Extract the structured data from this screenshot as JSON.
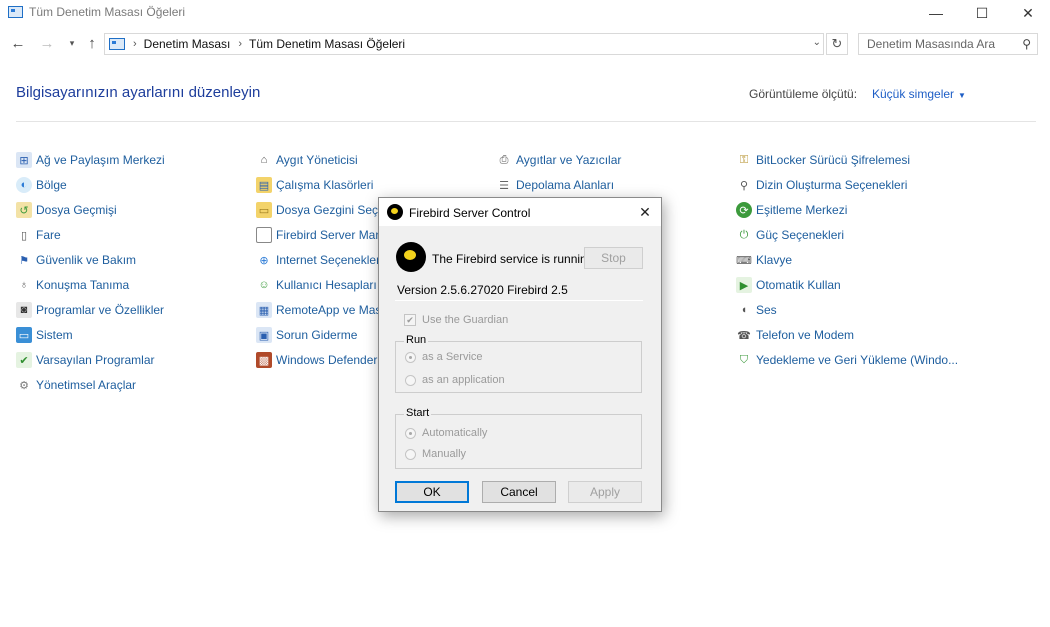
{
  "window": {
    "title": "Tüm Denetim Masası Öğeleri",
    "minimize_glyph": "—",
    "maximize_glyph": "☐",
    "close_glyph": "✕"
  },
  "address": {
    "crumbs": [
      "Denetim Masası",
      "Tüm Denetim Masası Öğeleri"
    ],
    "search_placeholder": "Denetim Masasında Ara"
  },
  "header": {
    "title": "Bilgisayarınızın ayarlarını düzenleyin",
    "view_by_label": "Görüntüleme ölçütü:",
    "view_by_value": "Küçük simgeler"
  },
  "items": [
    {
      "label": "Ağ ve Paylaşım Merkezi",
      "icon": "network-icon"
    },
    {
      "label": "Bölge",
      "icon": "globe-clock-icon"
    },
    {
      "label": "Dosya Geçmişi",
      "icon": "file-history-icon"
    },
    {
      "label": "Fare",
      "icon": "mouse-icon"
    },
    {
      "label": "Güvenlik ve Bakım",
      "icon": "flag-icon"
    },
    {
      "label": "Konuşma Tanıma",
      "icon": "microphone-icon"
    },
    {
      "label": "Programlar ve Özellikler",
      "icon": "programs-icon"
    },
    {
      "label": "Sistem",
      "icon": "computer-icon"
    },
    {
      "label": "Varsayılan Programlar",
      "icon": "default-programs-icon"
    },
    {
      "label": "Yönetimsel Araçlar",
      "icon": "admin-tools-icon"
    },
    {
      "label": "Aygıt Yöneticisi",
      "icon": "device-manager-icon"
    },
    {
      "label": "Çalışma Klasörleri",
      "icon": "work-folders-icon"
    },
    {
      "label": "Dosya Gezgini Seçe",
      "icon": "folder-options-icon"
    },
    {
      "label": "Firebird Server Man",
      "icon": "document-icon"
    },
    {
      "label": "Internet Seçenekleri",
      "icon": "internet-options-icon"
    },
    {
      "label": "Kullanıcı Hesapları",
      "icon": "users-icon"
    },
    {
      "label": "RemoteApp ve Mas",
      "icon": "remoteapp-icon"
    },
    {
      "label": "Sorun Giderme",
      "icon": "troubleshoot-icon"
    },
    {
      "label": "Windows Defender",
      "icon": "firewall-icon"
    },
    {
      "label": "Aygıtlar ve Yazıcılar",
      "icon": "printer-icon"
    },
    {
      "label": "Depolama Alanları",
      "icon": "storage-icon"
    },
    {
      "label": "BitLocker Sürücü Şifrelemesi",
      "icon": "bitlocker-icon"
    },
    {
      "label": "Dizin Oluşturma Seçenekleri",
      "icon": "indexing-icon"
    },
    {
      "label": "Eşitleme Merkezi",
      "icon": "sync-icon"
    },
    {
      "label": "Güç Seçenekleri",
      "icon": "power-icon"
    },
    {
      "label": "Klavye",
      "icon": "keyboard-icon"
    },
    {
      "label": "Otomatik Kullan",
      "icon": "autoplay-icon"
    },
    {
      "label": "Ses",
      "icon": "speaker-icon"
    },
    {
      "label": "Telefon ve Modem",
      "icon": "phone-icon"
    },
    {
      "label": "Yedekleme ve Geri Yükleme (Windo...",
      "icon": "backup-icon"
    }
  ],
  "dialog": {
    "title": "Firebird Server Control",
    "status": "The Firebird service is running.",
    "stop_label": "Stop",
    "version": "Version 2.5.6.27020 Firebird 2.5",
    "use_guardian_label": "Use the Guardian",
    "use_guardian_checked": true,
    "run_legend": "Run",
    "run_service_label": "as a Service",
    "run_app_label": "as an application",
    "run_selected": "as a Service",
    "start_legend": "Start",
    "start_auto_label": "Automatically",
    "start_manual_label": "Manually",
    "start_selected": "Automatically",
    "ok_label": "OK",
    "cancel_label": "Cancel",
    "apply_label": "Apply"
  },
  "colors": {
    "link": "#1e5e9e",
    "heading": "#1e3e9c",
    "firebird_yellow": "#f3d21c"
  }
}
